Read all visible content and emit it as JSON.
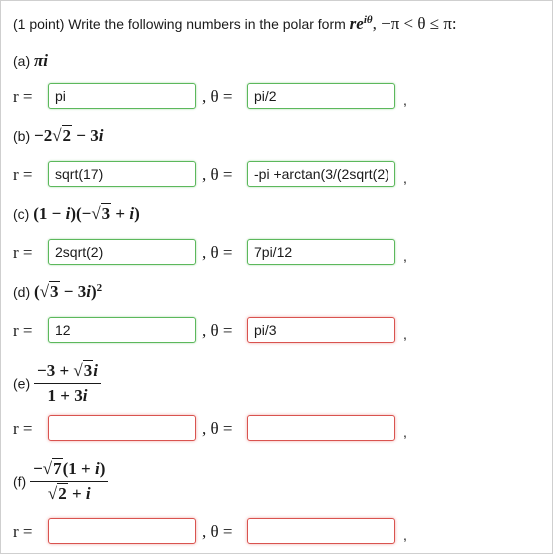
{
  "header": {
    "points": "(1 point) Write the following numbers in the polar form ",
    "form_r": "r",
    "form_e": "e",
    "form_exp": "iθ",
    "range": ", −π < θ ≤ π:"
  },
  "eq": {
    "r": "r =",
    "theta": ", θ =",
    "comma": ","
  },
  "parts": [
    {
      "label": "(a)",
      "expr_a": "π",
      "expr_b": "i",
      "r_value": "pi",
      "r_status": "correct",
      "theta_value": "pi/2",
      "theta_status": "correct"
    },
    {
      "label": "(b)",
      "expr_a": "−2",
      "expr_rad": "2",
      "expr_b": "− 3",
      "expr_c": "i",
      "r_value": "sqrt(17)",
      "r_status": "correct",
      "theta_value": "-pi +arctan(3/(2sqrt(2)",
      "theta_status": "correct"
    },
    {
      "label": "(c)",
      "expr_a": "(1 − ",
      "expr_i1": "i",
      "expr_b": ")(−",
      "expr_rad": "3",
      "expr_c": " + ",
      "expr_i2": "i",
      "expr_d": ")",
      "r_value": "2sqrt(2)",
      "r_status": "correct",
      "theta_value": "7pi/12",
      "theta_status": "correct"
    },
    {
      "label": "(d)",
      "expr_a": "(",
      "expr_rad": "3",
      "expr_b": " − 3",
      "expr_i": "i",
      "expr_c": ")",
      "expr_exp": "2",
      "r_value": "12",
      "r_status": "correct",
      "theta_value": "pi/3",
      "theta_status": "incorrect"
    },
    {
      "label": "(e)",
      "num_a": "−3 + ",
      "num_rad": "3",
      "num_i": "i",
      "den_a": "1 + 3",
      "den_i": "i",
      "r_value": "",
      "r_status": "incorrect",
      "theta_value": "",
      "theta_status": "incorrect"
    },
    {
      "label": "(f)",
      "num_a": "−",
      "num_rad": "7",
      "num_b": "(1 + ",
      "num_i": "i",
      "num_c": ")",
      "den_rad": "2",
      "den_b": " + ",
      "den_i": "i",
      "r_value": "",
      "r_status": "incorrect",
      "theta_value": "",
      "theta_status": "incorrect"
    }
  ],
  "colors": {
    "correct": "#5cb85c",
    "incorrect": "#d9534f"
  }
}
